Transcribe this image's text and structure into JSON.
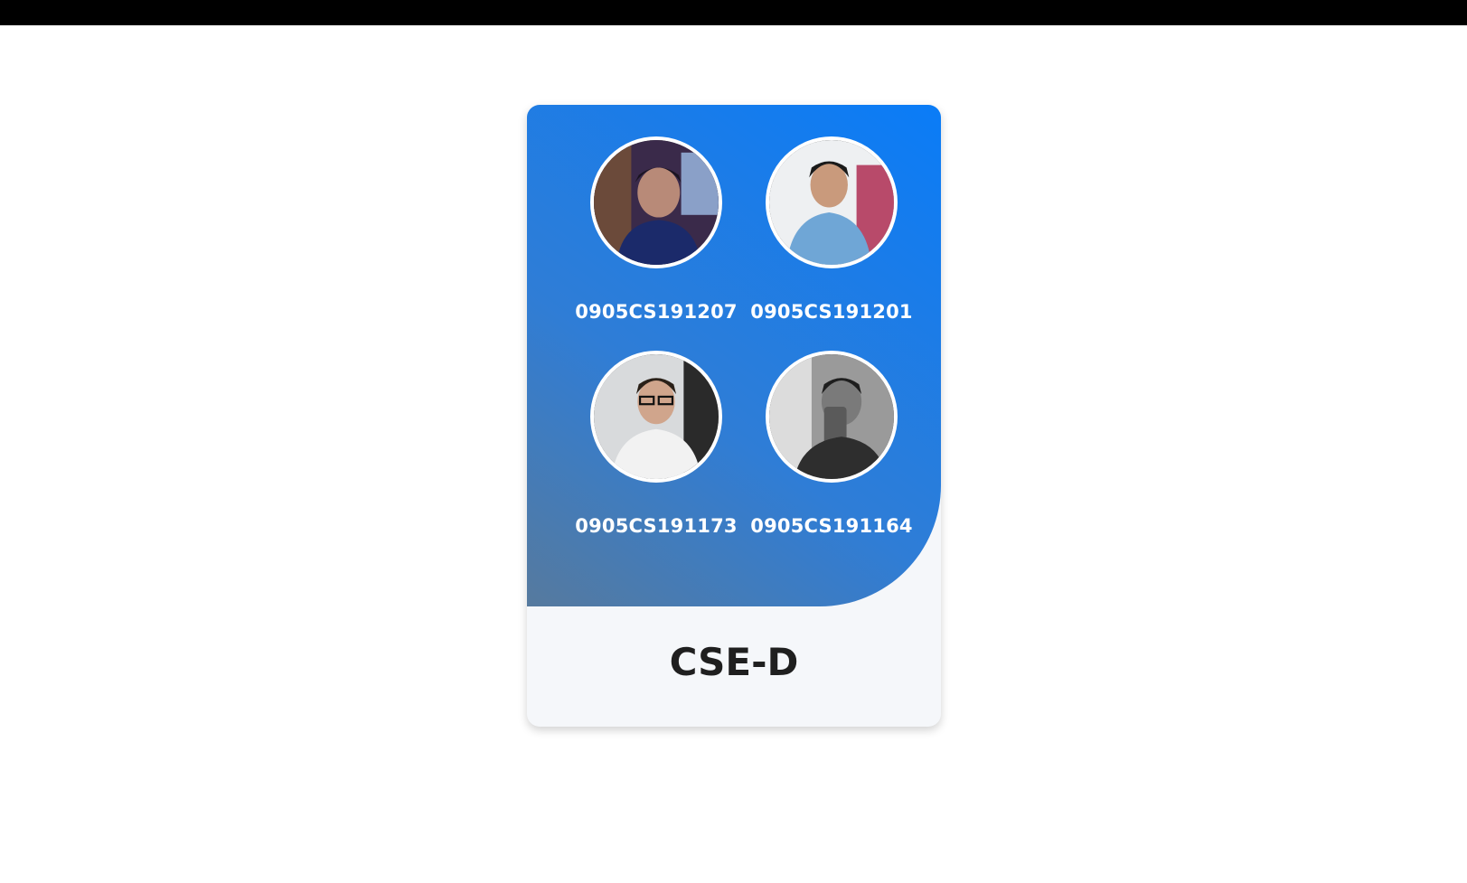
{
  "card": {
    "title": "CSE-D",
    "members": [
      {
        "id": "0905CS191207",
        "photo": "avatar-photo-member-1"
      },
      {
        "id": "0905CS191201",
        "photo": "avatar-photo-member-2"
      },
      {
        "id": "0905CS191173",
        "photo": "avatar-photo-member-3"
      },
      {
        "id": "0905CS191164",
        "photo": "avatar-photo-member-4"
      }
    ]
  },
  "colors": {
    "banner_start": "#567a9e",
    "banner_end": "#0a7cf7",
    "card_bottom": "#f5f7fa",
    "top_bar": "#000000"
  }
}
